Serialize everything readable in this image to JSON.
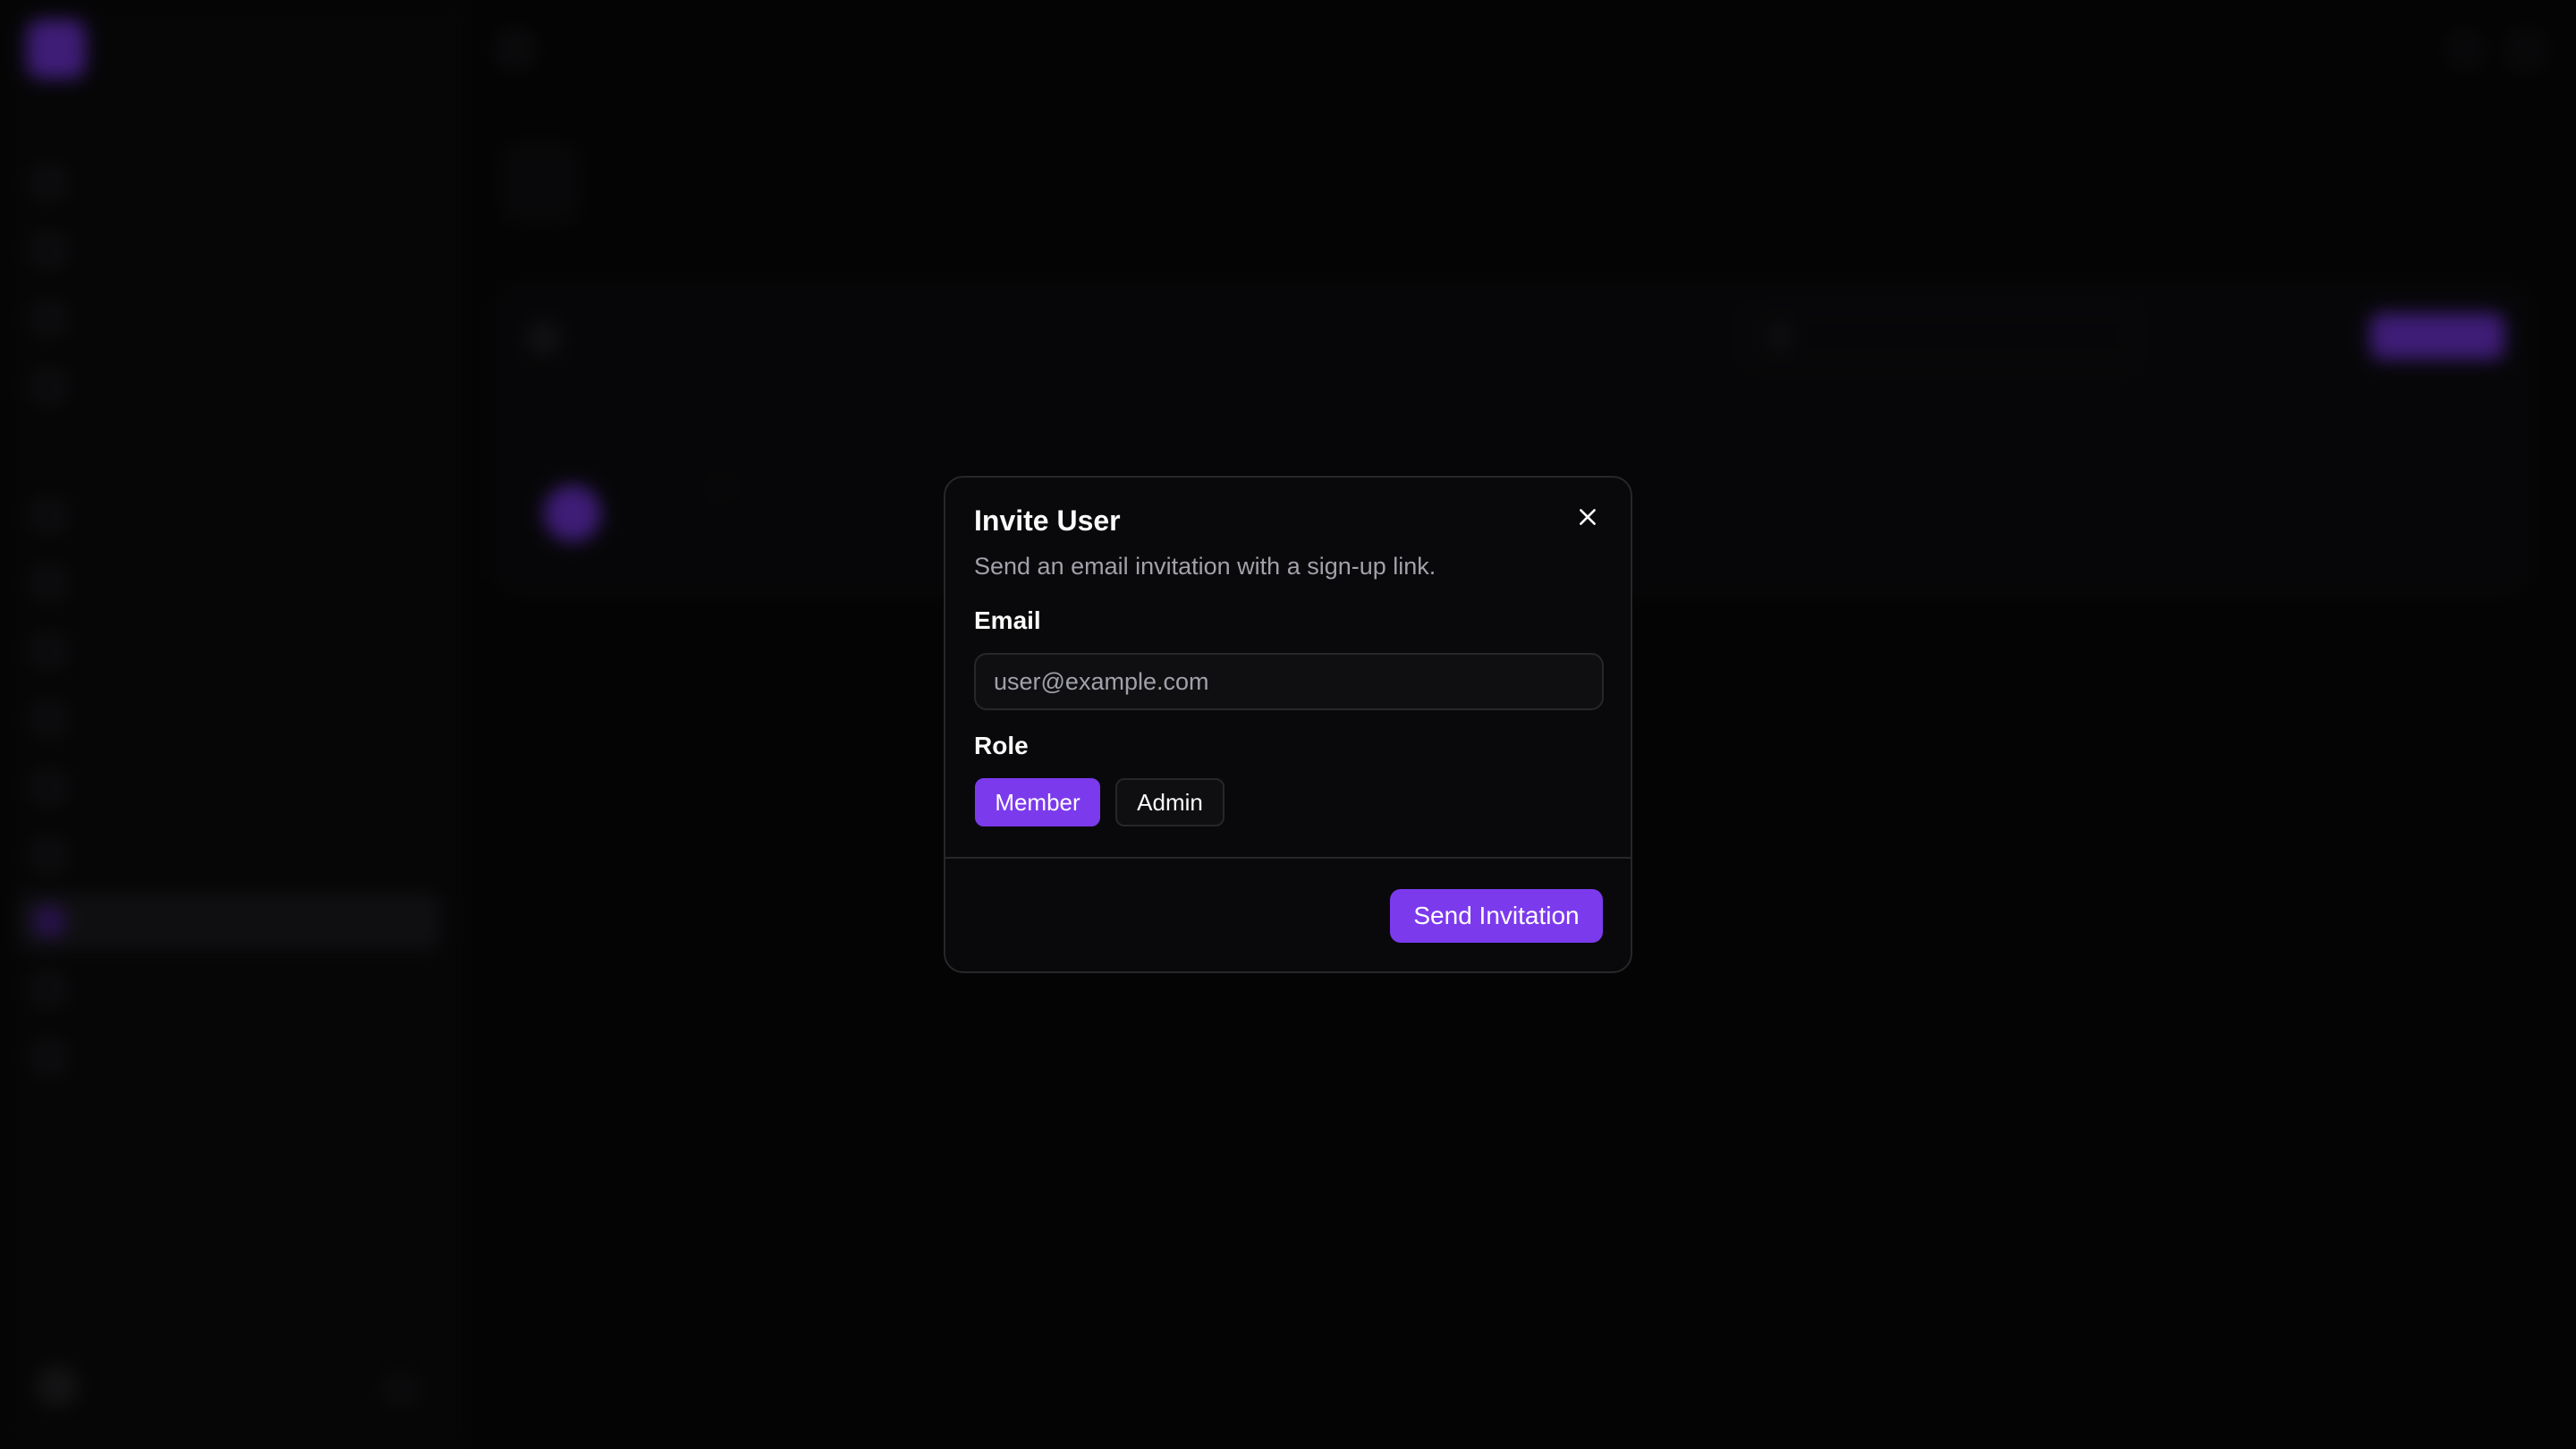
{
  "colors": {
    "accent": "#7c3aed",
    "background": "#09090b",
    "border": "#27272a",
    "muted_text": "#a1a1aa"
  },
  "dialog": {
    "title": "Invite User",
    "description": "Send an email invitation with a sign-up link.",
    "close_icon": "close-icon",
    "email": {
      "label": "Email",
      "value": "",
      "placeholder": "user@example.com"
    },
    "role": {
      "label": "Role",
      "options": [
        "Member",
        "Admin"
      ],
      "selected": "Member"
    },
    "submit_label": "Send Invitation"
  }
}
